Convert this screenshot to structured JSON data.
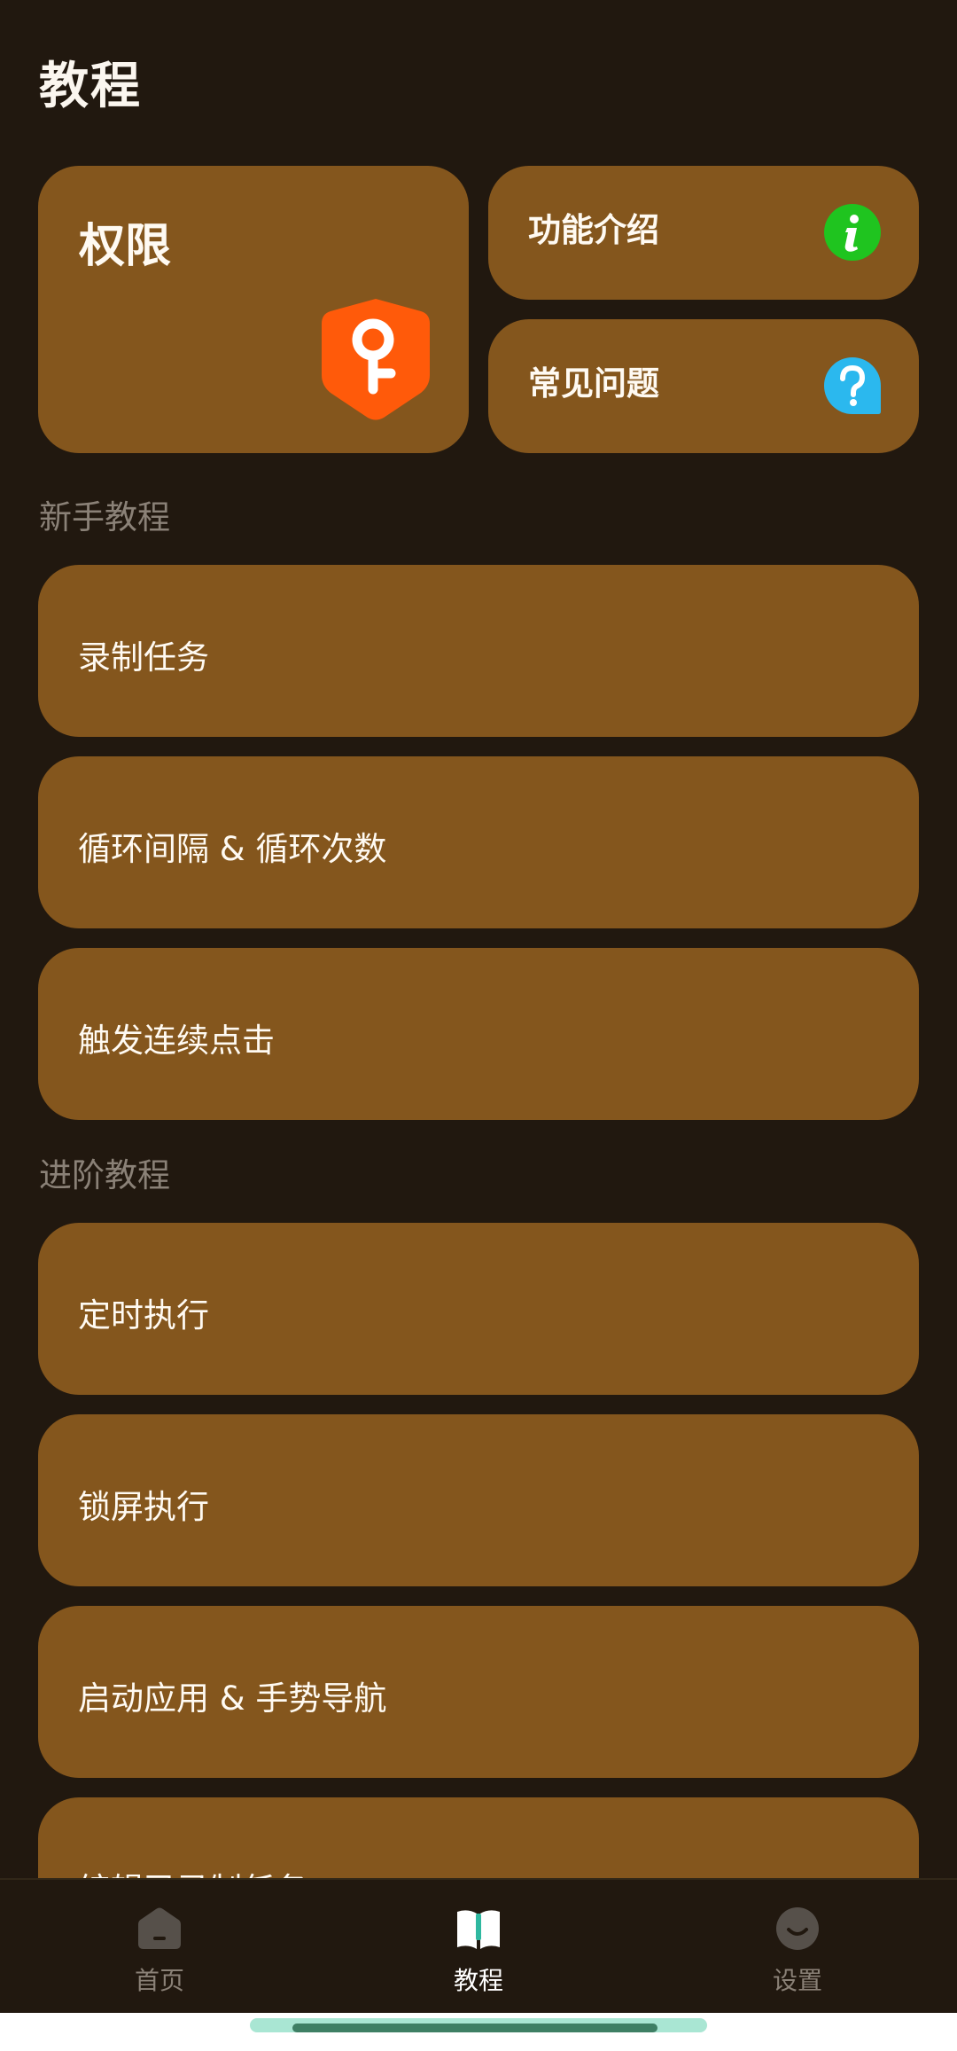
{
  "header": {
    "title": "教程"
  },
  "quick_cards": {
    "permissions": {
      "label": "权限",
      "icon": "key-shield-icon"
    },
    "features": {
      "label": "功能介绍",
      "icon": "info-icon",
      "icon_color": "#1fc41f"
    },
    "faq": {
      "label": "常见问题",
      "icon": "question-icon",
      "icon_color": "#2bb8ee"
    }
  },
  "beginner": {
    "title": "新手教程",
    "items": [
      {
        "label": "录制任务"
      },
      {
        "label": "循环间隔 & 循环次数"
      },
      {
        "label": "触发连续点击"
      }
    ]
  },
  "advanced": {
    "title": "进阶教程",
    "items": [
      {
        "label": "定时执行"
      },
      {
        "label": "锁屏执行"
      },
      {
        "label": "启动应用 & 手势导航"
      },
      {
        "label": "编辑已录制任务"
      }
    ]
  },
  "bottom_nav": {
    "items": [
      {
        "label": "首页",
        "icon": "home-icon",
        "active": false
      },
      {
        "label": "教程",
        "icon": "book-icon",
        "active": true
      },
      {
        "label": "设置",
        "icon": "smiley-icon",
        "active": false
      }
    ]
  },
  "colors": {
    "background": "#21180f",
    "card": "#84561d",
    "section_title": "#8a8177",
    "accent_orange": "#ff5a0a"
  }
}
